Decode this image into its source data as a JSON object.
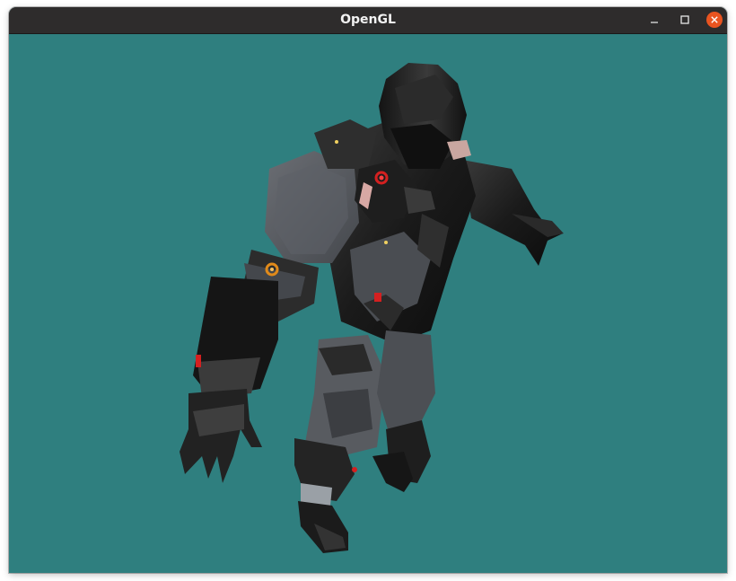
{
  "window": {
    "title": "OpenGL",
    "titlebar_color": "#2e2c2c",
    "background_color": "#2f7f7f",
    "close_button_color": "#e95420",
    "controls": {
      "minimize_icon": "minimize-icon",
      "maximize_icon": "maximize-icon",
      "close_icon": "close-icon"
    }
  },
  "scene": {
    "subject": "armored-soldier-model",
    "armor_color": "#1c1c1c",
    "plate_color": "#55585e",
    "accent_red": "#d42020",
    "accent_orange": "#e08a1a"
  }
}
